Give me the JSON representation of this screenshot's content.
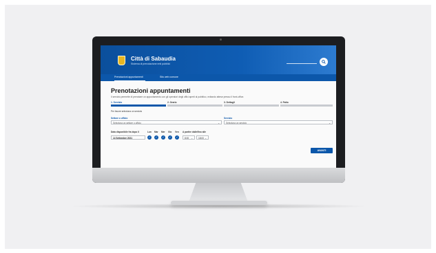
{
  "site": {
    "city_name": "Città di Sabaudia",
    "city_subtitle": "Sistema di prenotazione enti pubblici"
  },
  "nav": {
    "items": [
      {
        "label": "Prenotazioni appuntamenti",
        "active": true
      },
      {
        "label": "Sito web comune",
        "active": false
      }
    ]
  },
  "page": {
    "title": "Prenotazioni appuntamenti",
    "description": "Il servizio permette di prenotare un appuntamento con gli operatori degli uffici aperti al pubblico, evitando attese presso il front-office."
  },
  "steps": [
    {
      "label": "1. Servizio",
      "active": true
    },
    {
      "label": "2. Orario",
      "active": false
    },
    {
      "label": "3. Dettagli",
      "active": false
    },
    {
      "label": "4. Fatto",
      "active": false
    }
  ],
  "form": {
    "hint": "Per favore seleziona un servizio",
    "sector_label": "Settore o ufficio",
    "sector_value": "Seleziona un settore o ufficio",
    "service_label": "Servizio",
    "service_value": "Seleziona un servizio",
    "first_date_label": "Data disponibile fra dopo il",
    "first_date_value": "14 Settembre 2021",
    "days": [
      "Lun",
      "Mar",
      "Mer",
      "Gio",
      "Ven"
    ],
    "from_time_label": "A partire dalle/fino alle",
    "from_time": "8:00",
    "to_time": "18:00",
    "next_button": "AVANTI"
  },
  "colors": {
    "brand": "#0c57aa",
    "accent_yellow": "#e8b622"
  }
}
